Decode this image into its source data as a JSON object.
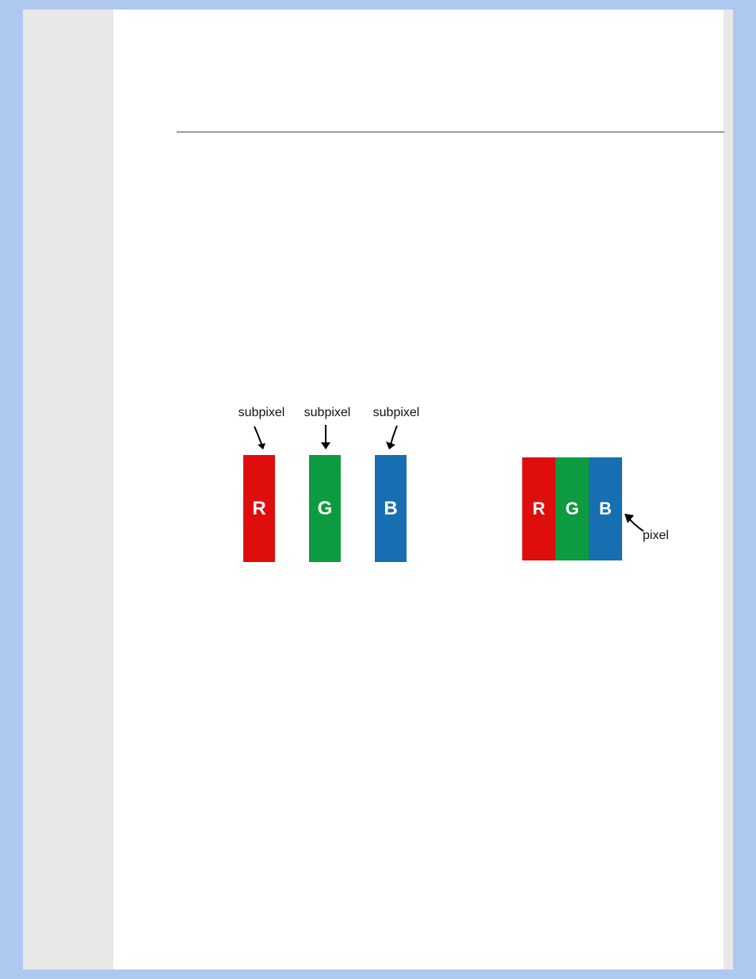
{
  "diagram": {
    "subpixels": [
      {
        "label": "subpixel",
        "letter": "R",
        "color": "#e00d0d"
      },
      {
        "label": "subpixel",
        "letter": "G",
        "color": "#0d9b3f"
      },
      {
        "label": "subpixel",
        "letter": "B",
        "color": "#176eb0"
      }
    ],
    "pixel": {
      "label": "pixel",
      "letters": {
        "r": "R",
        "g": "G",
        "b": "B"
      }
    }
  }
}
